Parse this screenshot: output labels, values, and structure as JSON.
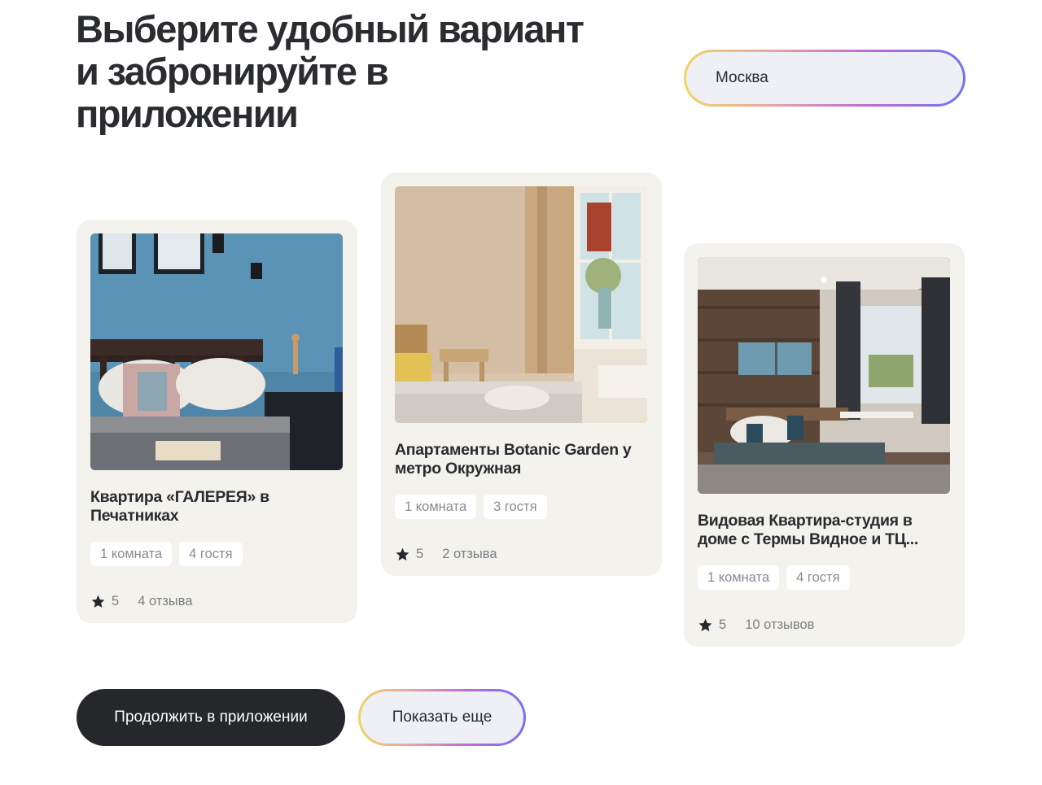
{
  "headline": "Выберите удобный вариант и забронируйте в приложении",
  "city": {
    "value": "Москва"
  },
  "cards": [
    {
      "title": "Квартира «ГАЛЕРЕЯ» в Печатниках",
      "tags": [
        "1 комната",
        "4 гостя"
      ],
      "rating": "5",
      "reviews": "4 отзыва"
    },
    {
      "title": "Апартаменты Botanic Garden у метро Окружная",
      "tags": [
        "1 комната",
        "3 гостя"
      ],
      "rating": "5",
      "reviews": "2 отзыва"
    },
    {
      "title": "Видовая Квартира-студия в доме с Термы Видное и ТЦ...",
      "tags": [
        "1 комната",
        "4 гостя"
      ],
      "rating": "5",
      "reviews": "10 отзывов"
    }
  ],
  "buttons": {
    "continue_label": "Продолжить в приложении",
    "more_label": "Показать еще"
  },
  "colors": {
    "dark": "#26272b",
    "card_bg": "#f3f2ec",
    "pill_bg": "#eef0f6",
    "gradient": [
      "#f0d466",
      "#c06ad6",
      "#6f74f2"
    ]
  }
}
